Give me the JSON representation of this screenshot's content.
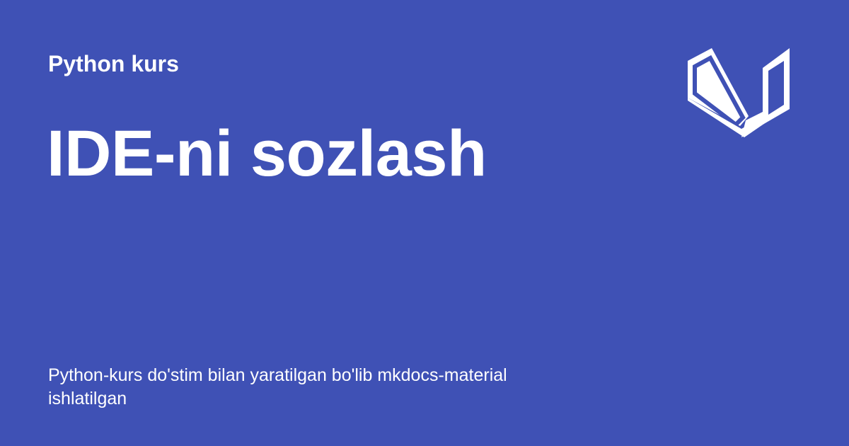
{
  "card": {
    "site_name": "Python kurs",
    "page_title": "IDE-ni sozlash",
    "description": "Python-kurs do'stim bilan yaratilgan bo'lib mkdocs-material ishlatilgan",
    "logo_icon": "mkdocs-material-logo-icon"
  },
  "colors": {
    "background": "#3f51b5",
    "foreground": "#ffffff"
  }
}
